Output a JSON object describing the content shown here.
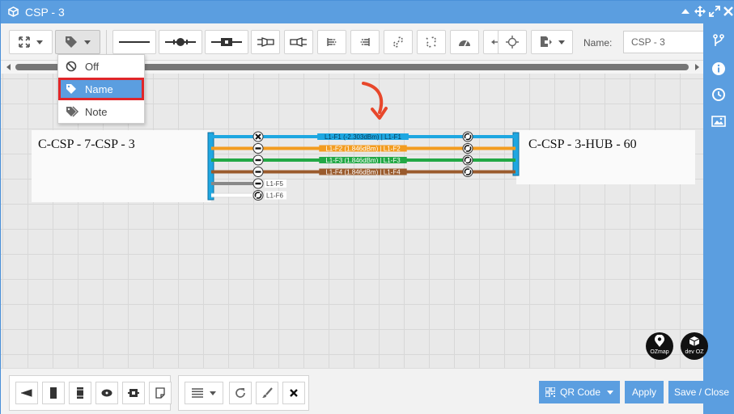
{
  "window": {
    "title": "CSP - 3"
  },
  "toolbar": {
    "name_label": "Name:",
    "name_value": "CSP - 3"
  },
  "label_menu": {
    "items": [
      {
        "label": "Off",
        "icon": "ban-icon"
      },
      {
        "label": "Name",
        "icon": "tag-icon",
        "selected": true
      },
      {
        "label": "Note",
        "icon": "tags-icon"
      }
    ]
  },
  "diagram": {
    "left_node": "C-CSP - 7-CSP - 3",
    "right_node": "C-CSP - 3-HUB - 60",
    "fibers": [
      {
        "label": "L1-F1 (-2.303dBm) | L1-F1",
        "color": "#1ea7e1",
        "left_connector": "cross",
        "right_connector": "link"
      },
      {
        "label": "L1-F2 (1.846dBm) | L1-F2",
        "color": "#f39c1f",
        "left_connector": "minus",
        "right_connector": "link"
      },
      {
        "label": "L1-F3 (1.846dBm) | L1-F3",
        "color": "#22a845",
        "left_connector": "minus",
        "right_connector": "link"
      },
      {
        "label": "L1-F4 (1.846dBm) | L1-F4",
        "color": "#9a5b2d",
        "left_connector": "minus",
        "right_connector": "link"
      },
      {
        "label": "L1-F5",
        "color": "#888888",
        "left_connector": "minus",
        "right_connector": ""
      },
      {
        "label": "L1-F6",
        "color": "#ffffff",
        "left_connector": "link",
        "right_connector": ""
      }
    ]
  },
  "logos": {
    "ozmap": "OZmap",
    "devoz": "dev OZ"
  },
  "bottom": {
    "qr_label": "QR Code",
    "apply_label": "Apply",
    "save_label": "Save / Close"
  },
  "colors": {
    "accent": "#5b9ee0",
    "highlight": "#e0262a",
    "arrow": "#e8472b"
  }
}
